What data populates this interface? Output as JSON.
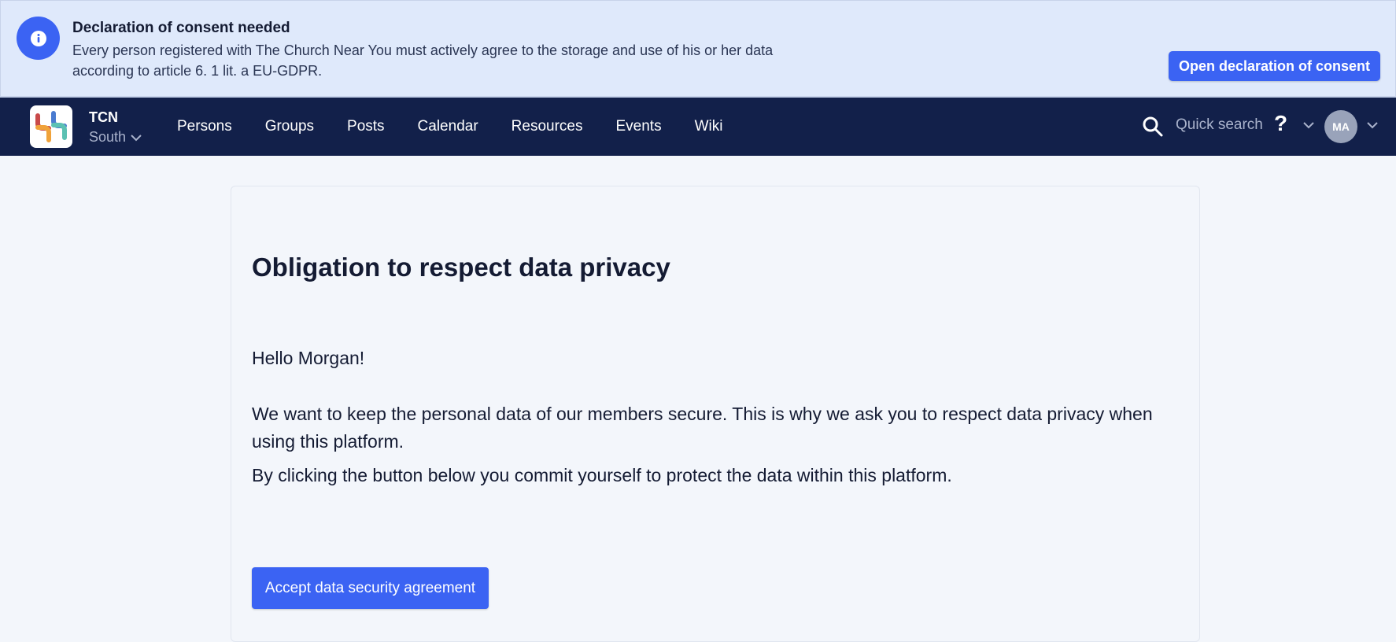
{
  "banner": {
    "title": "Declaration of consent needed",
    "text_line1": "Every person registered with The Church Near You must actively agree to the storage and use of his or her data",
    "text_line2": "according to article 6. 1 lit. a EU-GDPR.",
    "button_label": "Open declaration of consent",
    "icon": "info-icon"
  },
  "nav": {
    "org_name": "TCN",
    "org_sub": "South",
    "links": [
      "Persons",
      "Groups",
      "Posts",
      "Calendar",
      "Resources",
      "Events",
      "Wiki"
    ],
    "quick_search": "Quick search",
    "help": "?",
    "avatar_initials": "MA"
  },
  "main": {
    "title": "Obligation to respect data privacy",
    "greeting": "Hello Morgan!",
    "paragraph1": "We want to keep the personal data of our members secure. This is why we ask you to respect data privacy when using this platform.",
    "paragraph2": "By clicking the button below you commit yourself to protect the data within this platform.",
    "accept_label": "Accept data security agreement"
  },
  "colors": {
    "accent": "#3b63f3",
    "nav_bg": "#12204a",
    "banner_bg": "#dfe9fb",
    "page_bg": "#f3f6fb"
  }
}
